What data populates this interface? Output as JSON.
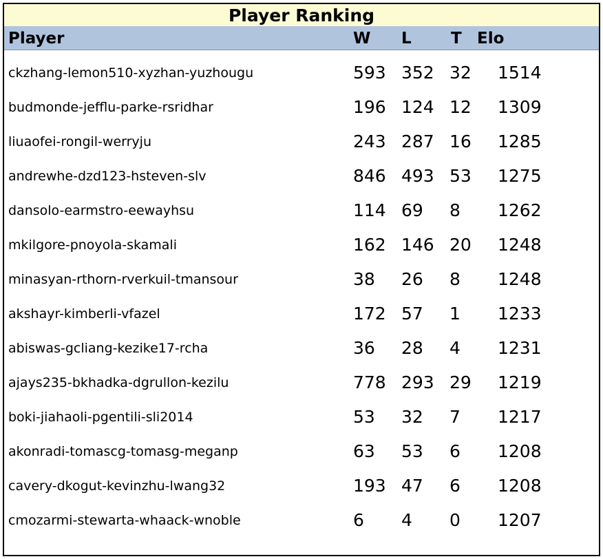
{
  "title": "Player Ranking",
  "headers": {
    "player": "Player",
    "w": "W",
    "l": "L",
    "t": "T",
    "elo": "Elo"
  },
  "colors": {
    "title_bg": "#fdfbd4",
    "header_bg": "#b0c4de"
  },
  "rows": [
    {
      "player": "ckzhang-lemon510-xyzhan-yuzhougu",
      "w": "593",
      "l": "352",
      "t": "32",
      "elo": "1514"
    },
    {
      "player": "budmonde-jefflu-parke-rsridhar",
      "w": "196",
      "l": "124",
      "t": "12",
      "elo": "1309"
    },
    {
      "player": "liuaofei-rongil-werryju",
      "w": "243",
      "l": "287",
      "t": "16",
      "elo": "1285"
    },
    {
      "player": "andrewhe-dzd123-hsteven-slv",
      "w": "846",
      "l": "493",
      "t": "53",
      "elo": "1275"
    },
    {
      "player": "dansolo-earmstro-eewayhsu",
      "w": "114",
      "l": "69",
      "t": "8",
      "elo": "1262"
    },
    {
      "player": "mkilgore-pnoyola-skamali",
      "w": "162",
      "l": "146",
      "t": "20",
      "elo": "1248"
    },
    {
      "player": "minasyan-rthorn-rverkuil-tmansour",
      "w": "38",
      "l": "26",
      "t": "8",
      "elo": "1248"
    },
    {
      "player": "akshayr-kimberli-vfazel",
      "w": "172",
      "l": "57",
      "t": "1",
      "elo": "1233"
    },
    {
      "player": "abiswas-gcliang-kezike17-rcha",
      "w": "36",
      "l": "28",
      "t": "4",
      "elo": "1231"
    },
    {
      "player": "ajays235-bkhadka-dgrullon-kezilu",
      "w": "778",
      "l": "293",
      "t": "29",
      "elo": "1219"
    },
    {
      "player": "boki-jiahaoli-pgentili-sli2014",
      "w": "53",
      "l": "32",
      "t": "7",
      "elo": "1217"
    },
    {
      "player": "akonradi-tomascg-tomasg-meganp",
      "w": "63",
      "l": "53",
      "t": "6",
      "elo": "1208"
    },
    {
      "player": "cavery-dkogut-kevinzhu-lwang32",
      "w": "193",
      "l": "47",
      "t": "6",
      "elo": "1208"
    },
    {
      "player": "cmozarmi-stewarta-whaack-wnoble",
      "w": "6",
      "l": "4",
      "t": "0",
      "elo": "1207"
    }
  ]
}
